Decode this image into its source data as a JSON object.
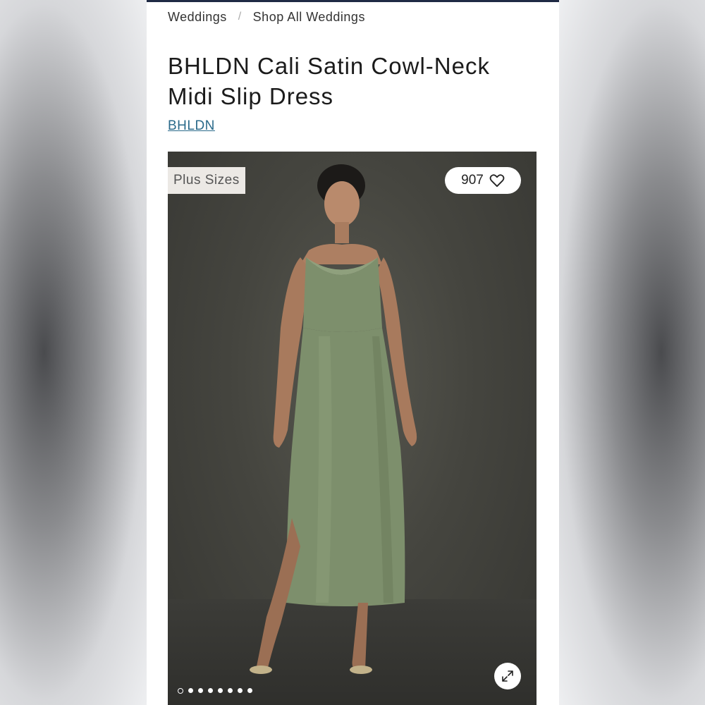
{
  "breadcrumb": {
    "items": [
      "Weddings",
      "Shop All Weddings"
    ],
    "separator": "/"
  },
  "product": {
    "title": "BHLDN Cali Satin Cowl-Neck Midi Slip Dress",
    "brand": "BHLDN",
    "badge": "Plus Sizes",
    "likes": "907"
  },
  "gallery": {
    "image_count": 8,
    "active_index": 0,
    "dress_color": "#7d8f6c"
  },
  "icons": {
    "like": "heart-outline-icon",
    "expand": "expand-arrows-icon"
  },
  "colors": {
    "top_bar": "#1f2a44",
    "brand_link": "#2a6a8a",
    "badge_bg": "#ece9e5"
  }
}
